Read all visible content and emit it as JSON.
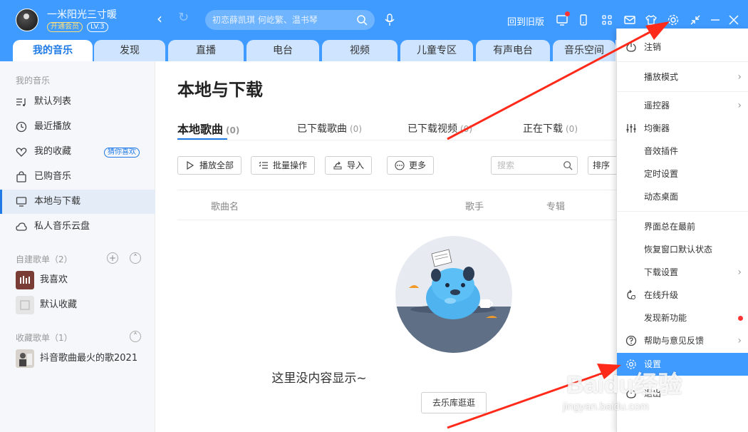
{
  "colors": {
    "accent": "#3f9bff",
    "active_text": "#1f7ae6",
    "annotation_arrow": "#ff2a1a"
  },
  "user": {
    "name": "一米阳光三寸暖",
    "vip_label": "开通会员",
    "level": "LV.3"
  },
  "search": {
    "placeholder": "初恋薛凯琪 何屹繁、温书琴"
  },
  "topbar": {
    "old_version": "回到旧版"
  },
  "tabs": [
    {
      "label": "我的音乐",
      "active": true
    },
    {
      "label": "发现"
    },
    {
      "label": "直播"
    },
    {
      "label": "电台"
    },
    {
      "label": "视频"
    },
    {
      "label": "儿童专区"
    },
    {
      "label": "有声电台"
    },
    {
      "label": "音乐空间"
    }
  ],
  "sidebar": {
    "section_title": "我的音乐",
    "items": [
      {
        "label": "默认列表",
        "icon": "music-list-icon"
      },
      {
        "label": "最近播放",
        "icon": "clock-icon"
      },
      {
        "label": "我的收藏",
        "icon": "heart-icon",
        "badge": "猜你喜欢"
      },
      {
        "label": "已购音乐",
        "icon": "bag-icon"
      },
      {
        "label": "本地与下载",
        "icon": "monitor-icon",
        "active": true
      },
      {
        "label": "私人音乐云盘",
        "icon": "cloud-icon"
      }
    ],
    "created_title": "自建歌单（2）",
    "created": [
      {
        "label": "我喜欢",
        "icon": "liked-playlist-icon"
      },
      {
        "label": "默认收藏",
        "icon": "default-collection-icon"
      }
    ],
    "collected_title": "收藏歌单（1）",
    "collected": [
      {
        "label": "抖音歌曲最火的歌2021",
        "icon": "playlist-cover"
      }
    ]
  },
  "main": {
    "title": "本地与下载",
    "subtabs": [
      {
        "label": "本地歌曲",
        "count": "(0)",
        "active": true
      },
      {
        "label": "已下载歌曲",
        "count": "(0)"
      },
      {
        "label": "已下载视频",
        "count": "(0)"
      },
      {
        "label": "正在下载",
        "count": "(0)"
      }
    ],
    "buttons": {
      "play_all": "播放全部",
      "batch": "批量操作",
      "import": "导入",
      "more": "更多"
    },
    "search_placeholder": "搜索",
    "sort": "排序",
    "columns": {
      "song": "歌曲名",
      "artist": "歌手",
      "album": "专辑"
    },
    "empty_text": "这里没内容显示~",
    "go_library": "去乐库逛逛"
  },
  "menu": {
    "items": [
      {
        "label": "注销",
        "icon": "logout-icon"
      },
      {
        "label": "播放模式",
        "arrow": true
      },
      {
        "label": "遥控器",
        "arrow": true
      },
      {
        "label": "均衡器",
        "icon": "equalizer-icon"
      },
      {
        "label": "音效插件"
      },
      {
        "label": "定时设置"
      },
      {
        "label": "动态桌面"
      },
      {
        "label": "界面总在最前"
      },
      {
        "label": "恢复窗口默认状态"
      },
      {
        "label": "下载设置",
        "arrow": true
      },
      {
        "label": "在线升级",
        "icon": "upgrade-icon"
      },
      {
        "label": "发现新功能",
        "new_dot": true
      },
      {
        "label": "帮助与意见反馈",
        "icon": "help-icon",
        "arrow": true
      },
      {
        "label": "设置",
        "icon": "settings-icon",
        "highlighted": true
      },
      {
        "label": "退出",
        "icon": "power-icon"
      }
    ]
  },
  "watermark": {
    "brand": "Baidu经验",
    "url": "jingyan.baidu.com"
  }
}
